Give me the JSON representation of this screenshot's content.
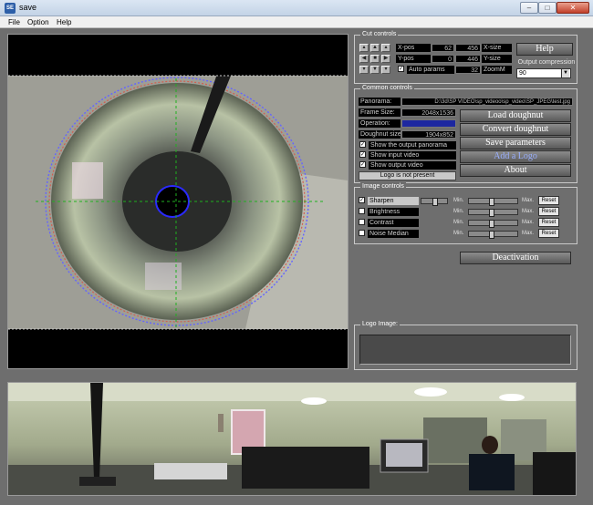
{
  "window": {
    "title": "save",
    "icon_label": "SE",
    "min_label": "–",
    "max_label": "□",
    "close_label": "✕"
  },
  "menu": [
    "File",
    "Option",
    "Help"
  ],
  "cut_controls": {
    "title": "Cut controls",
    "xpos_label": "X-pos",
    "xpos_value": "62",
    "xsize_label": "X-size",
    "xsize_value": "456",
    "ypos_label": "Y-pos",
    "ypos_value": "0",
    "ysize_label": "Y-size",
    "ysize_value": "446",
    "auto_params_label": "Auto params",
    "zoom_value": "32",
    "zoom_label": "ZoomM",
    "help_button": "Help",
    "compression_label": "Output compression",
    "compression_value": "90"
  },
  "common_controls": {
    "title": "Common controls",
    "panorama_label": "Panorama:",
    "panorama_value": "D:\\3d\\SP VIDEO\\sp_videoo\\sp_video\\SP_JPEG\\test.jpg",
    "frame_size_label": "Frame Size:",
    "frame_size_value": "2048x1536",
    "operation_label": "Operation:",
    "doughnut_size_label": "Doughnut size:",
    "doughnut_size_value": "1904x852",
    "show_output_panorama": "Show the output panorama",
    "show_input_video": "Show input video",
    "show_output_video": "Show output video",
    "logo_status": "Logo is not present",
    "load_doughnut": "Load doughnut",
    "convert_doughnut": "Convert doughnut",
    "save_parameters": "Save parameters",
    "add_logo": "Add a Logo",
    "about": "About"
  },
  "image_controls": {
    "title": "Image controls",
    "min_label": "Min.",
    "max_label": "Max.",
    "reset_label": "Reset",
    "rows": [
      {
        "label": "Sharpen",
        "checked": true
      },
      {
        "label": "Brightness",
        "checked": false
      },
      {
        "label": "Contrast",
        "checked": false
      },
      {
        "label": "Noise Median",
        "checked": false
      }
    ]
  },
  "deactivation": "Deactivation",
  "logo_image": {
    "title": "Logo Image:"
  },
  "colors": {
    "operation_bar": "#1d27a0",
    "window_bg": "#6e6e6e",
    "crosshair": "#1fb11f",
    "circle_outer": "#6464ff"
  }
}
